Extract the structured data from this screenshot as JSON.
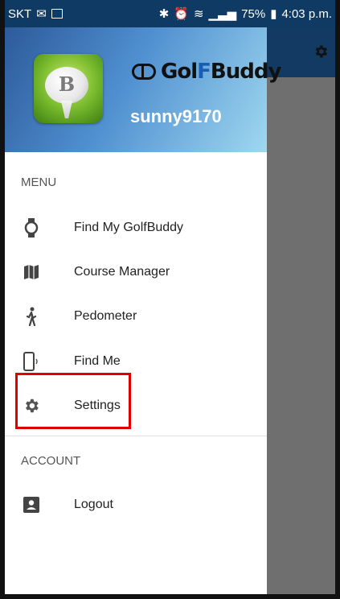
{
  "status_bar": {
    "carrier": "SKT",
    "battery": "75%",
    "time": "4:03 p.m."
  },
  "header": {
    "brand": "GolfBuddy",
    "brand_part1": "Gol",
    "brand_part2": "F",
    "brand_part3": "Buddy",
    "ball_letter": "B",
    "username": "sunny9170"
  },
  "menu": {
    "section_label": "MENU",
    "items": [
      {
        "label": "Find My GolfBuddy",
        "icon": "watch-icon"
      },
      {
        "label": "Course Manager",
        "icon": "map-icon"
      },
      {
        "label": "Pedometer",
        "icon": "walking-person-icon"
      },
      {
        "label": "Find Me",
        "icon": "phone-vibrate-icon"
      },
      {
        "label": "Settings",
        "icon": "gear-icon"
      }
    ]
  },
  "account": {
    "section_label": "ACCOUNT",
    "items": [
      {
        "label": "Logout",
        "icon": "account-box-icon"
      }
    ]
  },
  "colors": {
    "status_bar": "#0f3a63",
    "highlight": "#e00000",
    "scrim": "#6f6f6f"
  }
}
